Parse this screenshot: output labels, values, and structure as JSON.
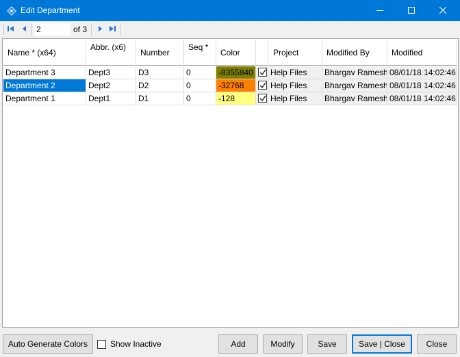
{
  "window": {
    "title": "Edit Department",
    "accent": "#0078d7"
  },
  "navigator": {
    "position": "2",
    "of_text": "of 3"
  },
  "grid": {
    "headers": {
      "name": "Name * (x64)",
      "abbr": "Abbr. (x6)",
      "number": "Number",
      "seq": "Seq *",
      "color": "Color",
      "project": "Project",
      "modified_by": "Modified By",
      "modified": "Modified"
    },
    "rows": [
      {
        "name": "Department 3",
        "abbr": "Dept3",
        "number": "D3",
        "seq": "0",
        "color_value": "-8355840",
        "color_hex": "#808000",
        "checked": true,
        "project": "Help Files",
        "modified_by": "Bhargav Ramesh",
        "modified": "08/01/18 14:02:46",
        "selected": false
      },
      {
        "name": "Department 2",
        "abbr": "Dept2",
        "number": "D2",
        "seq": "0",
        "color_value": "-32768",
        "color_hex": "#ff8000",
        "checked": true,
        "project": "Help Files",
        "modified_by": "Bhargav Ramesh",
        "modified": "08/01/18 14:02:46",
        "selected": true
      },
      {
        "name": "Department 1",
        "abbr": "Dept1",
        "number": "D1",
        "seq": "0",
        "color_value": "-128",
        "color_hex": "#ffff80",
        "checked": true,
        "project": "Help Files",
        "modified_by": "Bhargav Ramesh",
        "modified": "08/01/18 14:02:46",
        "selected": false
      }
    ]
  },
  "footer": {
    "auto_generate_label": "Auto Generate Colors",
    "show_inactive_label": "Show Inactive",
    "show_inactive_checked": false,
    "add_label": "Add",
    "modify_label": "Modify",
    "save_label": "Save",
    "save_close_label": "Save | Close",
    "close_label": "Close"
  },
  "icons": {
    "app": "app-diamond-icon",
    "minimize": "minimize-icon",
    "maximize": "maximize-icon",
    "close": "close-icon",
    "first": "first-record-icon",
    "prev": "previous-record-icon",
    "next": "next-record-icon",
    "last": "last-record-icon",
    "check": "checkmark-icon"
  }
}
